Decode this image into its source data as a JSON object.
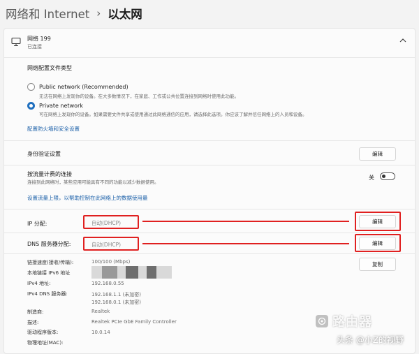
{
  "breadcrumb": {
    "parent": "网络和 Internet",
    "separator": "›",
    "current": "以太网"
  },
  "network": {
    "name": "网络 199",
    "status": "已连接"
  },
  "profile": {
    "heading": "网络配置文件类型",
    "public_title": "Public network (Recommended)",
    "public_desc": "无法在网络上发现你的设备。在大多数情况下，在家庭、工作或公共位置连接到网络时使用此功能。",
    "private_title": "Private network",
    "private_desc": "可在网络上发现你的设备。如果需要文件共享或使用通过此网络通信的应用，请选择此选项。你应该了解并信任网络上的人员和设备。",
    "firewall_link": "配置防火墙和安全设置"
  },
  "auth": {
    "label": "身份验证设置",
    "button": "编辑"
  },
  "metered": {
    "label": "按流量计费的连接",
    "desc": "连接到此网络时，某些应用可能具有不同的功能以减少数据使用。",
    "toggle_label": "关",
    "toggle_on": false,
    "link": "设置流量上限，以帮助控制在此网络上的数据使用量"
  },
  "ip": {
    "label": "IP 分配:",
    "value": "自动(DHCP)",
    "button": "编辑"
  },
  "dns": {
    "label": "DNS 服务器分配:",
    "value": "自动(DHCP)",
    "button": "编辑"
  },
  "props": {
    "copy_button": "复制",
    "link_speed_label": "链接速度(接收/传输):",
    "link_speed_value": "100/100 (Mbps)",
    "ipv6_label": "本地链接 IPv6 地址",
    "ipv4_label": "IPv4 地址:",
    "ipv4_value": "192.168.0.55",
    "dns_servers_label": "IPv4 DNS 服务器:",
    "dns_server_1": "192.168.1.1 (未加密)",
    "dns_server_2": "192.168.0.1 (未加密)",
    "maker_label": "制造商:",
    "maker_value": "Realtek",
    "desc_label": "描述:",
    "desc_value": "Realtek PCIe GbE Family Controller",
    "driver_label": "驱动程序版本:",
    "driver_value": "10.0.14",
    "mac_label": "物理地址(MAC):"
  },
  "watermark": {
    "logo_text": "路由器",
    "credit": "头条 @小Z的视野"
  },
  "colors": {
    "accent": "#1f6fbf",
    "annotation": "#e02020",
    "link": "#1a5fa8"
  }
}
